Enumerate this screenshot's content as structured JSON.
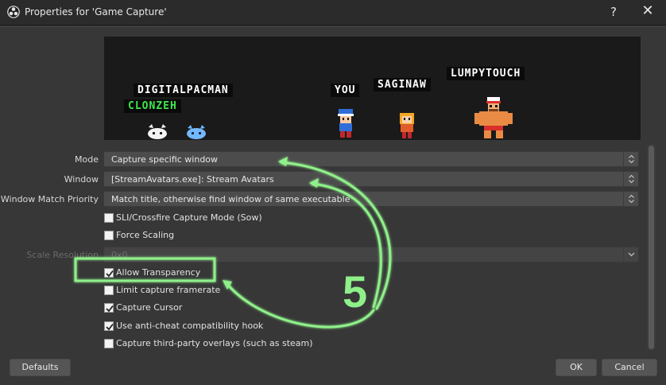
{
  "window": {
    "title": "Properties for 'Game Capture'",
    "help_label": "?",
    "close_label": "✕"
  },
  "preview": {
    "labels": [
      {
        "text": "DIGITALPACMAN",
        "color": "white"
      },
      {
        "text": "CLONZEH",
        "color": "green"
      },
      {
        "text": "YOU",
        "color": "white"
      },
      {
        "text": "SAGINAW",
        "color": "white"
      },
      {
        "text": "LUMPYTOUCH",
        "color": "white"
      }
    ]
  },
  "fields": {
    "mode": {
      "label": "Mode",
      "value": "Capture specific window"
    },
    "window": {
      "label": "Window",
      "value": "[StreamAvatars.exe]: Stream Avatars"
    },
    "match_priority": {
      "label": "Window Match Priority",
      "value": "Match title, otherwise find window of same executable"
    },
    "scale_resolution": {
      "label": "Scale Resolution",
      "value": "0x0"
    }
  },
  "checkboxes": [
    {
      "label": "SLI/Crossfire Capture Mode (Sow)",
      "checked": false
    },
    {
      "label": "Force Scaling",
      "checked": false
    },
    {
      "label": "Allow Transparency",
      "checked": true
    },
    {
      "label": "Limit capture framerate",
      "checked": false
    },
    {
      "label": "Capture Cursor",
      "checked": true
    },
    {
      "label": "Use anti-cheat compatibility hook",
      "checked": true
    },
    {
      "label": "Capture third-party overlays (such as steam)",
      "checked": false
    }
  ],
  "buttons": {
    "defaults": "Defaults",
    "ok": "OK",
    "cancel": "Cancel"
  },
  "annotation": {
    "number": "5",
    "color": "#8ff08a"
  },
  "colors": {
    "background": "#373737",
    "titlebar": "#2b2b2b",
    "combo": "#4c4c4c",
    "annotation_green": "#8ff08a"
  }
}
